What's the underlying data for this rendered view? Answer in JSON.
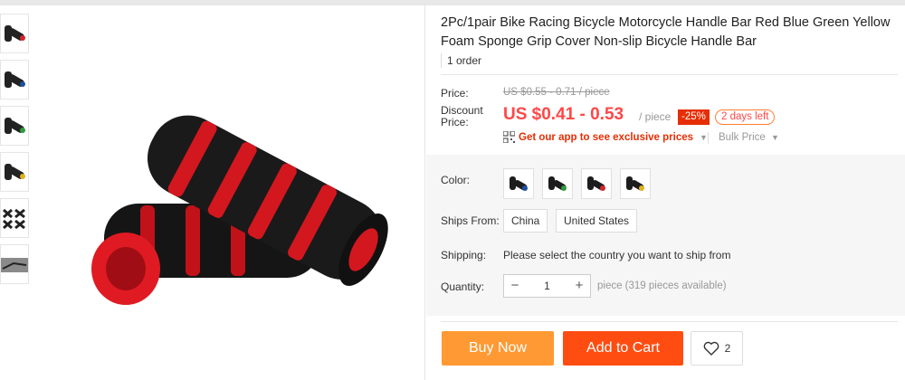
{
  "product": {
    "title": "2Pc/1pair Bike Racing Bicycle Motorcycle Handle Bar Red Blue Green Yellow Foam Sponge Grip Cover Non-slip Bicycle Handle Bar",
    "orders": "1 order"
  },
  "thumbnails": [
    {
      "name": "thumb-red-grip",
      "accent": "#d3252a"
    },
    {
      "name": "thumb-blue-grip",
      "accent": "#1d4f9e"
    },
    {
      "name": "thumb-green-grip",
      "accent": "#2e9b3d"
    },
    {
      "name": "thumb-yellow-grip",
      "accent": "#e0b21a"
    },
    {
      "name": "thumb-multi-grip",
      "accent": "#555555"
    },
    {
      "name": "thumb-bike-photo",
      "accent": "#777777"
    }
  ],
  "pricing": {
    "price_label": "Price:",
    "original_price": "US $0.55 - 0.71 / piece",
    "discount_label": "Discount Price:",
    "discount_price": "US $0.41 - 0.53",
    "unit": "/ piece",
    "discount_badge": "-25%",
    "time_left": "2 days left",
    "app_prices": "Get our app to see exclusive prices",
    "bulk_price": "Bulk Price"
  },
  "options": {
    "color_label": "Color:",
    "colors": [
      {
        "name": "blue",
        "hex": "#1d4f9e"
      },
      {
        "name": "green",
        "hex": "#2e9b3d"
      },
      {
        "name": "red",
        "hex": "#d3252a"
      },
      {
        "name": "yellow",
        "hex": "#e0b21a"
      }
    ],
    "ships_from_label": "Ships From:",
    "ships_from": [
      "China",
      "United States"
    ],
    "shipping_label": "Shipping:",
    "shipping_message": "Please select the country you want to ship from",
    "quantity_label": "Quantity:",
    "quantity": "1",
    "quantity_note": "piece (319 pieces available)"
  },
  "actions": {
    "buy_now": "Buy Now",
    "add_to_cart": "Add to Cart",
    "wishlist_count": "2"
  },
  "colors": {
    "accent_red": "#ff4747",
    "buy_orange": "#ff9933",
    "cart_red": "#ff4d12",
    "panel_gray": "#f6f6f6"
  }
}
